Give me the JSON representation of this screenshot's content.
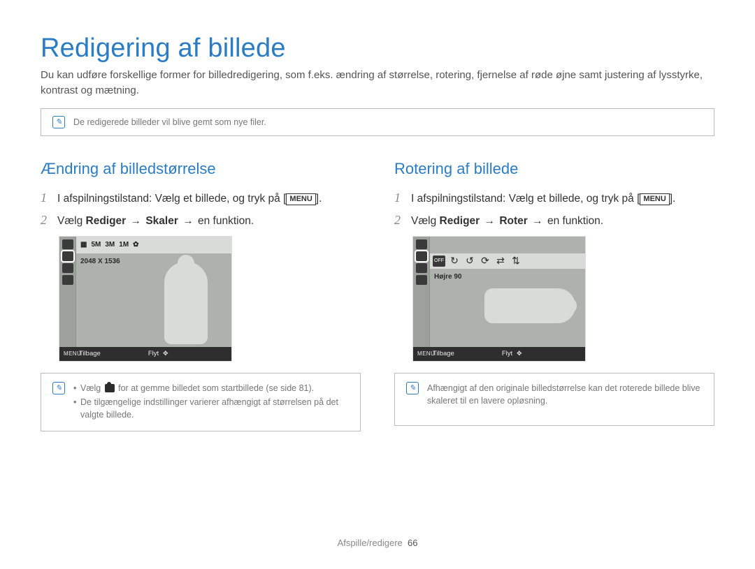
{
  "page": {
    "title": "Redigering af billede",
    "intro": "Du kan udføre forskellige former for billedredigering, som f.eks. ændring af størrelse, rotering, fjernelse af røde øjne samt justering af lysstyrke, kontrast og mætning.",
    "top_note": "De redigerede billeder vil blive gemt som nye filer."
  },
  "left": {
    "heading": "Ændring af billedstørrelse",
    "step1_text": "I afspilningstilstand: Vælg et billede, og tryk på [",
    "step1_end": "].",
    "menu_label": "MENU",
    "step2_pre": "Vælg ",
    "step2_b1": "Rediger",
    "step2_b2": "Skaler",
    "step2_post": " en funktion.",
    "lcd_label": "2048 X 1536",
    "back": "Tilbage",
    "move": "Flyt",
    "menu_word": "MENU",
    "note1": "Vælg {icon} for at gemme billedet som startbillede (se side 81).",
    "note2": "De tilgængelige indstillinger varierer afhængigt af størrelsen på det valgte billede.",
    "top_icons": [
      "5M",
      "3M",
      "1M"
    ]
  },
  "right": {
    "heading": "Rotering af billede",
    "step1_text": "I afspilningstilstand: Vælg et billede, og tryk på [",
    "step1_end": "].",
    "menu_label": "MENU",
    "step2_pre": "Vælg ",
    "step2_b1": "Rediger",
    "step2_b2": "Roter",
    "step2_post": " en funktion.",
    "lcd_label": "Højre 90",
    "back": "Tilbage",
    "move": "Flyt",
    "menu_word": "MENU",
    "note": "Afhængigt af den originale billedstørrelse kan det roterede billede blive skaleret til en lavere opløsning."
  },
  "footer": {
    "section": "Afspille/redigere",
    "page_num": "66"
  }
}
